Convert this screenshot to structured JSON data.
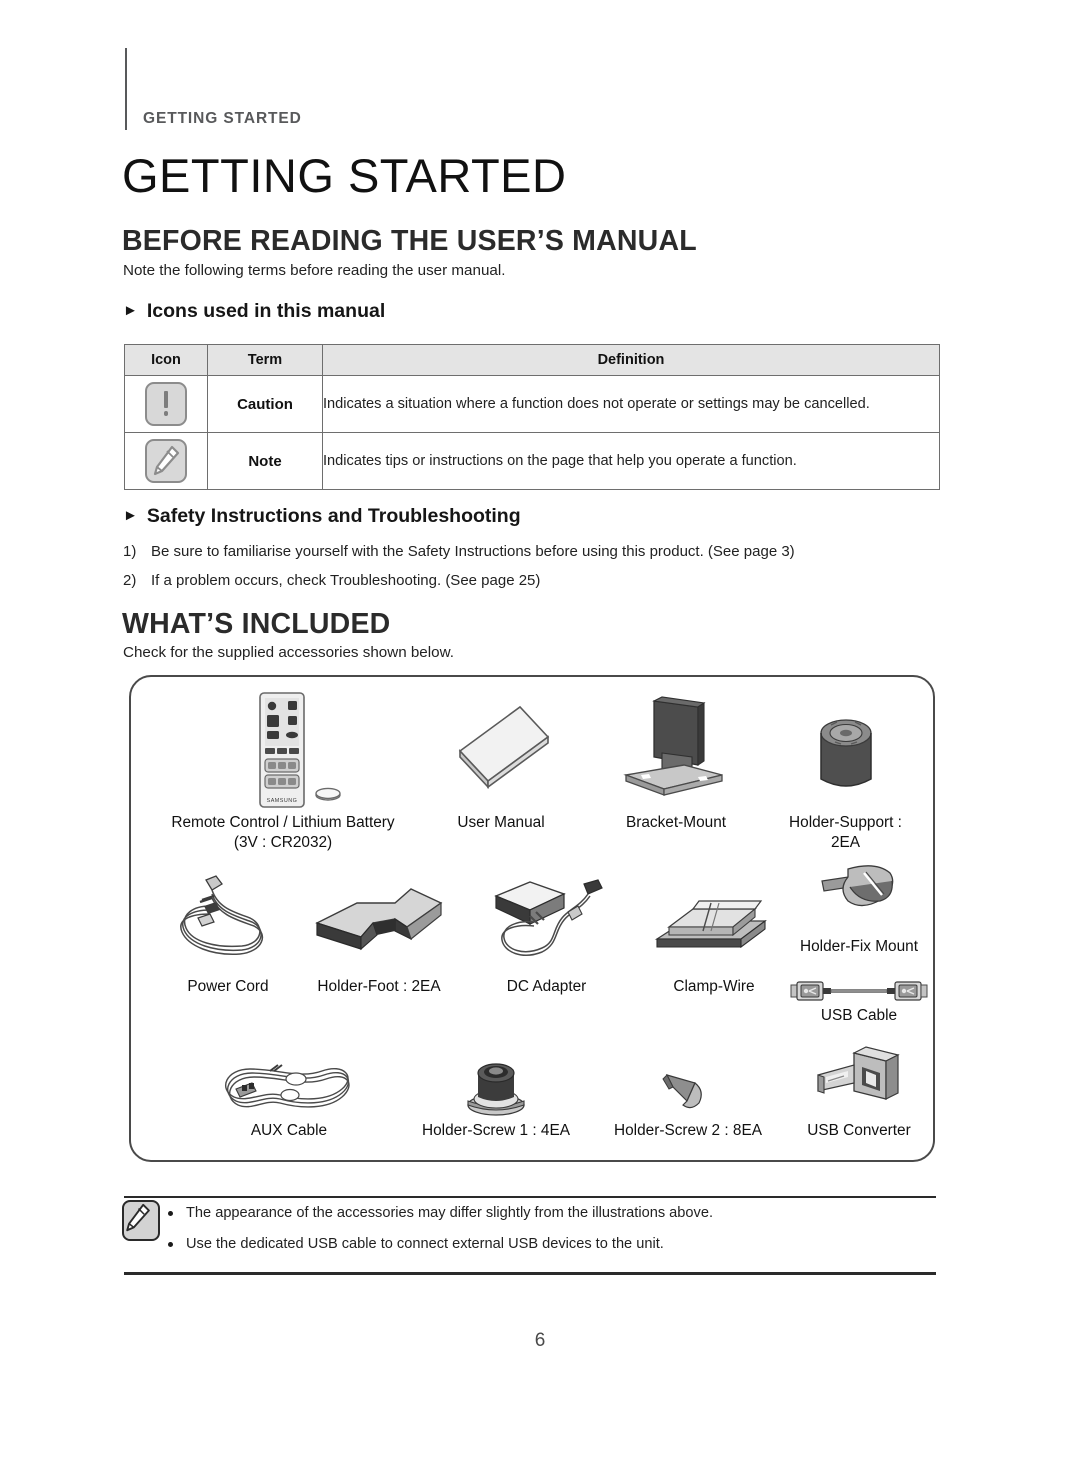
{
  "running_head": "GETTING STARTED",
  "chapter_title": "GETTING STARTED",
  "sections": {
    "before_reading": {
      "heading": "BEFORE READING THE USER’S MANUAL",
      "lead": "Note the following terms before reading the user manual.",
      "sub_icons": "Icons used in this manual",
      "sub_safety": "Safety Instructions and Troubleshooting"
    },
    "whats_included": {
      "heading": "WHAT’S INCLUDED",
      "lead": "Check for the supplied accessories shown below."
    }
  },
  "icons_table": {
    "headers": [
      "Icon",
      "Term",
      "Definition"
    ],
    "rows": [
      {
        "icon": "caution-icon",
        "term": "Caution",
        "definition": "Indicates a situation where a function does not operate or settings may be cancelled."
      },
      {
        "icon": "note-icon",
        "term": "Note",
        "definition": "Indicates tips or instructions on the page that help you operate a function."
      }
    ]
  },
  "safety_list": [
    {
      "num": "1)",
      "text": "Be sure to familiarise yourself with the Safety Instructions before using this product. (See page 3)"
    },
    {
      "num": "2)",
      "text": "If a problem occurs, check Troubleshooting. (See page 25)"
    }
  ],
  "accessories": [
    {
      "icon": "remote-control-icon",
      "label": "Remote Control / Lithium Battery",
      "label2": "(3V : CR2032)"
    },
    {
      "icon": "user-manual-icon",
      "label": "User Manual",
      "label2": ""
    },
    {
      "icon": "bracket-mount-icon",
      "label": "Bracket-Mount",
      "label2": ""
    },
    {
      "icon": "holder-support-icon",
      "label": "Holder-Support :",
      "label2": "2EA"
    },
    {
      "icon": "power-cord-icon",
      "label": "Power Cord",
      "label2": ""
    },
    {
      "icon": "holder-foot-icon",
      "label": "Holder-Foot : 2EA",
      "label2": ""
    },
    {
      "icon": "dc-adapter-icon",
      "label": "DC Adapter",
      "label2": ""
    },
    {
      "icon": "clamp-wire-icon",
      "label": "Clamp-Wire",
      "label2": ""
    },
    {
      "icon": "holder-fix-mount-icon",
      "label": "Holder-Fix Mount",
      "label2": ""
    },
    {
      "icon": "usb-cable-icon",
      "label": "USB Cable",
      "label2": ""
    },
    {
      "icon": "aux-cable-icon",
      "label": "AUX Cable",
      "label2": ""
    },
    {
      "icon": "holder-screw-1-icon",
      "label": "Holder-Screw 1 : 4EA",
      "label2": ""
    },
    {
      "icon": "holder-screw-2-icon",
      "label": "Holder-Screw 2 : 8EA",
      "label2": ""
    },
    {
      "icon": "usb-converter-icon",
      "label": "USB Converter",
      "label2": ""
    }
  ],
  "remote_brand": "SAMSUNG",
  "footnotes": {
    "icon": "note-icon",
    "items": [
      "The appearance of the accessories may differ slightly from the illustrations above.",
      "Use the dedicated USB cable to connect external USB devices to the unit."
    ]
  },
  "page_number": "6",
  "colors": {
    "ink": "#1a1a1a",
    "runhead": "#58595b",
    "table_header_bg": "#e4e4e4",
    "table_border": "#6e6e6e",
    "box_border": "#4a4a4a"
  }
}
